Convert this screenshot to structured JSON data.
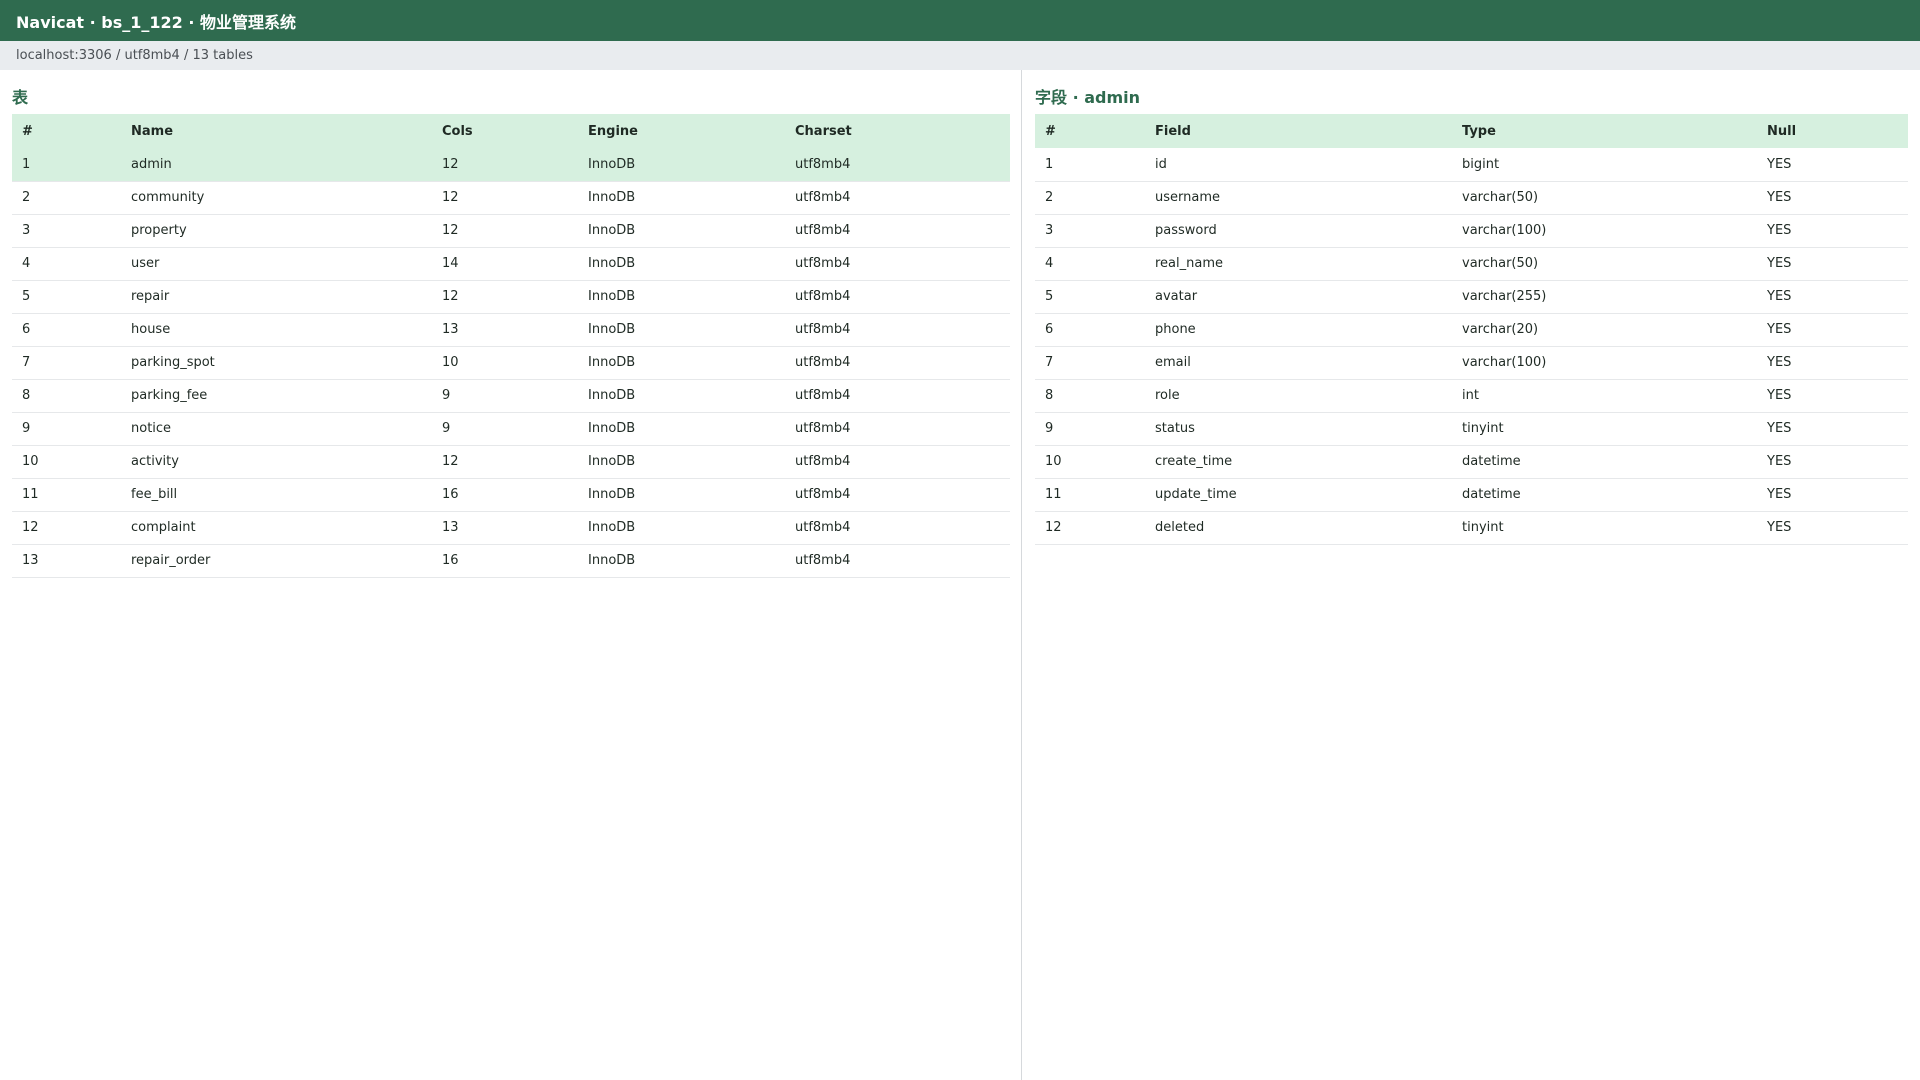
{
  "window": {
    "title": "Navicat · bs_1_122 · 物业管理系统",
    "path": "localhost:3306 / utf8mb4 / 13 tables"
  },
  "tables_pane": {
    "title": "表",
    "columns": [
      "#",
      "Name",
      "Cols",
      "Engine",
      "Charset"
    ],
    "selected_index": 0,
    "rows": [
      [
        "1",
        "admin",
        "12",
        "InnoDB",
        "utf8mb4"
      ],
      [
        "2",
        "community",
        "12",
        "InnoDB",
        "utf8mb4"
      ],
      [
        "3",
        "property",
        "12",
        "InnoDB",
        "utf8mb4"
      ],
      [
        "4",
        "user",
        "14",
        "InnoDB",
        "utf8mb4"
      ],
      [
        "5",
        "repair",
        "12",
        "InnoDB",
        "utf8mb4"
      ],
      [
        "6",
        "house",
        "13",
        "InnoDB",
        "utf8mb4"
      ],
      [
        "7",
        "parking_spot",
        "10",
        "InnoDB",
        "utf8mb4"
      ],
      [
        "8",
        "parking_fee",
        "9",
        "InnoDB",
        "utf8mb4"
      ],
      [
        "9",
        "notice",
        "9",
        "InnoDB",
        "utf8mb4"
      ],
      [
        "10",
        "activity",
        "12",
        "InnoDB",
        "utf8mb4"
      ],
      [
        "11",
        "fee_bill",
        "16",
        "InnoDB",
        "utf8mb4"
      ],
      [
        "12",
        "complaint",
        "13",
        "InnoDB",
        "utf8mb4"
      ],
      [
        "13",
        "repair_order",
        "16",
        "InnoDB",
        "utf8mb4"
      ]
    ]
  },
  "fields_pane": {
    "title": "字段 · admin",
    "columns": [
      "#",
      "Field",
      "Type",
      "Null"
    ],
    "rows": [
      [
        "1",
        "id",
        "bigint",
        "YES"
      ],
      [
        "2",
        "username",
        "varchar(50)",
        "YES"
      ],
      [
        "3",
        "password",
        "varchar(100)",
        "YES"
      ],
      [
        "4",
        "real_name",
        "varchar(50)",
        "YES"
      ],
      [
        "5",
        "avatar",
        "varchar(255)",
        "YES"
      ],
      [
        "6",
        "phone",
        "varchar(20)",
        "YES"
      ],
      [
        "7",
        "email",
        "varchar(100)",
        "YES"
      ],
      [
        "8",
        "role",
        "int",
        "YES"
      ],
      [
        "9",
        "status",
        "tinyint",
        "YES"
      ],
      [
        "10",
        "create_time",
        "datetime",
        "YES"
      ],
      [
        "11",
        "update_time",
        "datetime",
        "YES"
      ],
      [
        "12",
        "deleted",
        "tinyint",
        "YES"
      ]
    ]
  },
  "colors": {
    "titlebar": "#2f6b4f",
    "header_row": "#d6f0df",
    "selected_row": "#d6f0df",
    "pathbar": "#e9ecef"
  }
}
